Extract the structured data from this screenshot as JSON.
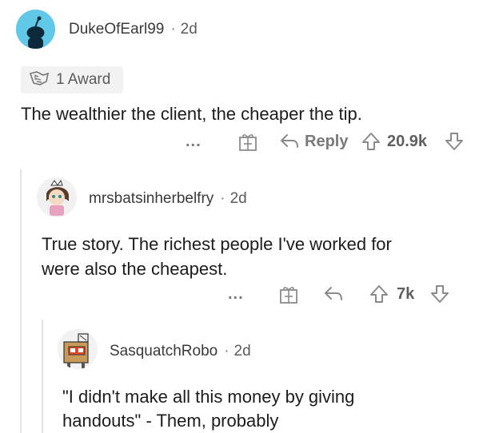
{
  "comments": [
    {
      "username": "DukeOfEarl99",
      "age": "2d",
      "award_count": "1 Award",
      "text": "The wealthier the client, the cheaper the tip.",
      "more": "...",
      "reply_label": "Reply",
      "votes": "20.9k"
    },
    {
      "username": "mrsbatsinherbelfry",
      "age": "2d",
      "text_line1": "True story. The richest people I've worked for",
      "text_line2": "were also the cheapest.",
      "more": "...",
      "votes": "7k"
    },
    {
      "username": "SasquatchRobo",
      "age": "2d",
      "text_line1": "\"I didn't make all this money by giving",
      "text_line2": "handouts\" - Them, probably"
    }
  ],
  "separator": "·",
  "colors": {
    "avatar_bg": "#62c8e8",
    "icon_gray": "#8a8a8a",
    "thread_line": "#e3e3e3"
  },
  "icons": [
    "snoo-avatar",
    "award-icon",
    "gift-icon",
    "reply-arrow-icon",
    "upvote-icon",
    "downvote-icon"
  ]
}
